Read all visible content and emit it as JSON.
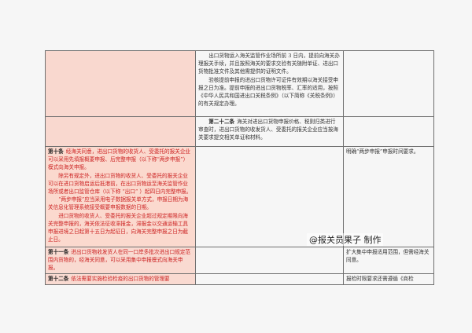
{
  "rows": [
    {
      "col1": [],
      "col2": [
        "出口货物运入海关监管作业场所前 3 日内，提前向海关办理报关手续，并且按照海关的要求交验有关随附单证、进出口货物批准文件及其他需提供的证明文件。",
        "验核提前申报的进出口货物许可证件有效期以海关接受申报之日为准。提前申报的进出口货物税率、汇率的适用，按照《中华人民共和国进出口关税条例》（以下简称《关税条例》）的有关规定办理。"
      ],
      "col3": []
    },
    {
      "col1": [],
      "col2_article": "第二十二条",
      "col2": [
        "海关对进出口货物申报价格、税则归类进行审查时，进出口货物的收发货人、受委托的报关企业应当按海关要求提交相关单证和材料。"
      ],
      "col3": []
    },
    {
      "col1_article": "第十条",
      "col1": [
        "经海关同意，进出口货物的收货人、受委托的报关企业可以采用先填报概要申报、后完整申报（以下称“两步申报”）模式向海关申报。",
        "除另有规定外，进出口货物的收货人、受委托的报关企业可以在进口货物启运后抵港前，在出口货物运至海关监管作业场所或者出口监管仓库（以下称 “出口” ）起四日内完整申报。",
        "“两步申报”应当采用电子数据报关单方式，申报日期为海关信息化管理系统接受概要申报数据的日期。",
        "进口货物的收货人、受委托的报关企业超过规定期限向海关完整申报的，海关依法征收滞报金，滞报金以交通运输工具申报进境之日起第十五日为起征日，向海关完整申报之日为截止日。"
      ],
      "col2": [],
      "col3": [
        "明确“两步申报”申报时间要求。"
      ]
    },
    {
      "col1_article": "第十一条",
      "col1": [
        "进出口货物收发货人在同一口岸多批次进出口规定范围内货物的，经海关同意，可以采用集中申报模式向海关申报。"
      ],
      "col2": [],
      "col3": [
        "扩大集中申报适用范围，但需经海关同意。"
      ]
    },
    {
      "col1_article": "第十二条",
      "col1": [
        "依法需要实施检验检疫的出口货物的管理要"
      ],
      "col2": [],
      "col3": [
        "报检时限要求还需遵循《商检"
      ]
    }
  ],
  "watermark": "@报关员果子 制作",
  "colors": {
    "highlight": "#f9d8cf",
    "red_text": "#cc2222",
    "border": "#6f6f6f"
  }
}
